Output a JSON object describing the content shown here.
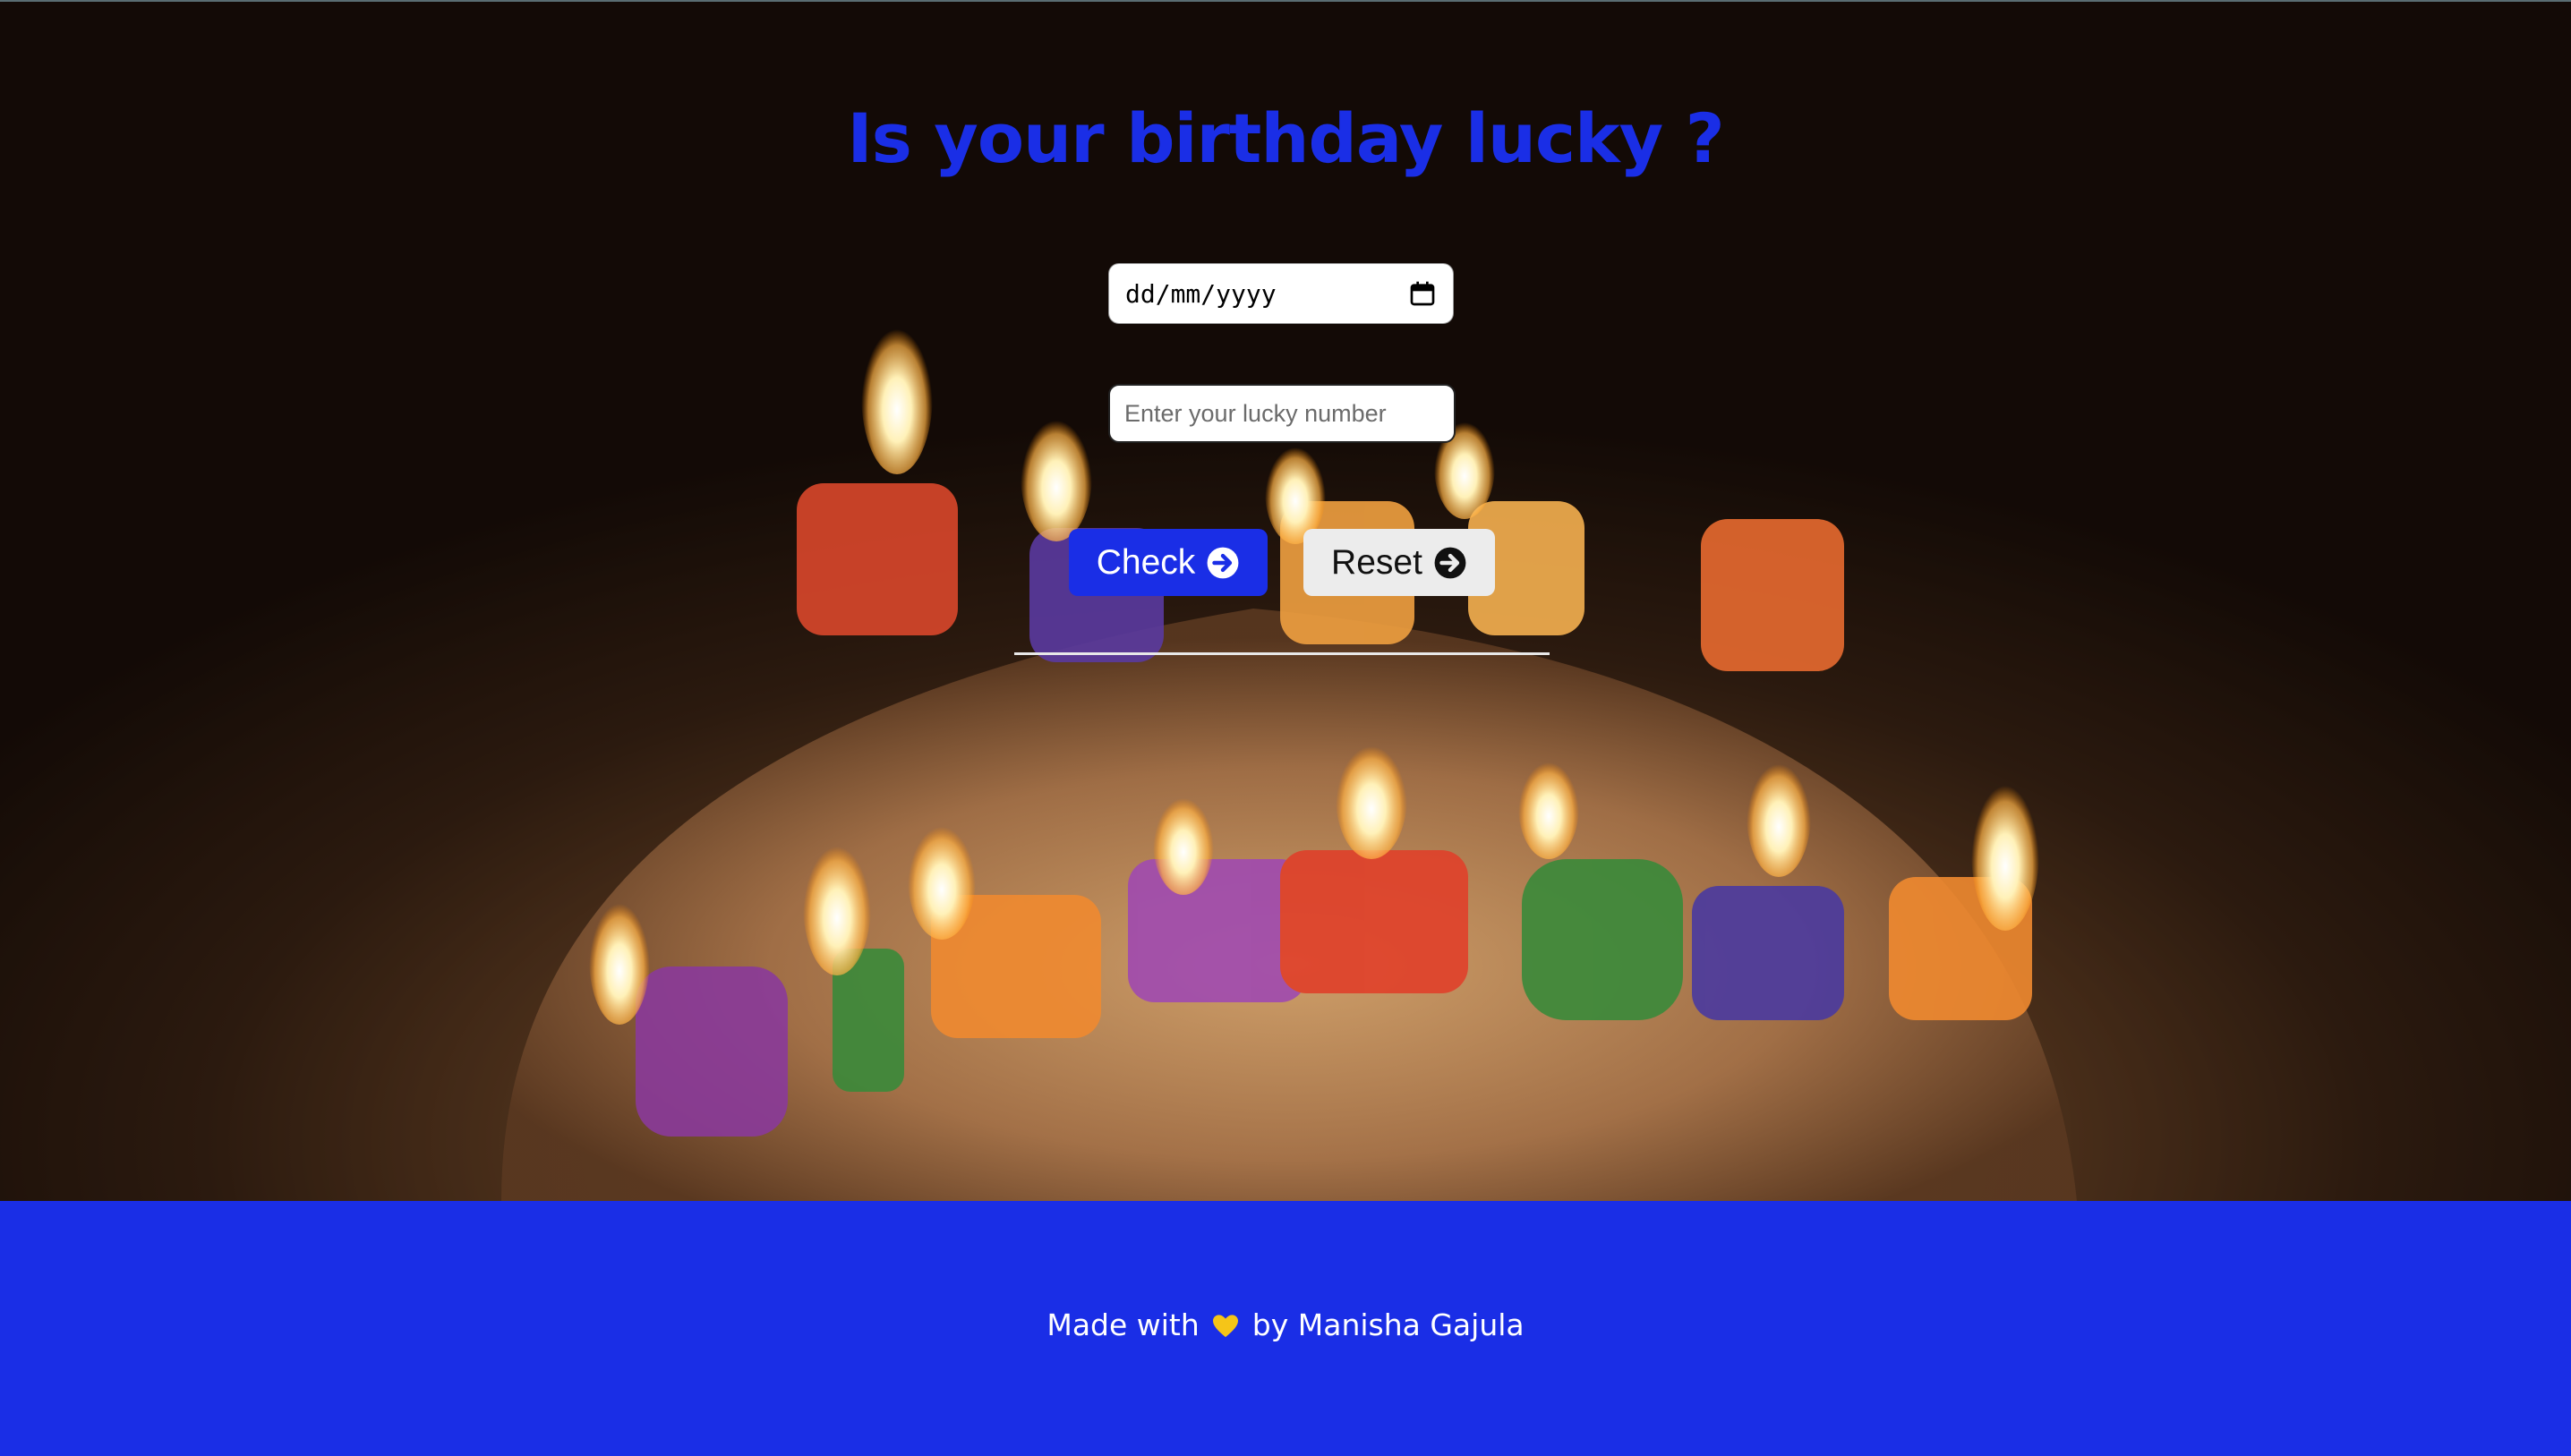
{
  "page": {
    "title": "Is your birthday lucky ?"
  },
  "form": {
    "date_placeholder": "dd/mm/yyyy",
    "lucky_placeholder": "Enter your lucky number",
    "check_label": "Check",
    "reset_label": "Reset"
  },
  "footer": {
    "prefix": "Made with",
    "suffix": "by Manisha Gajula"
  },
  "icons": {
    "calendar": "calendar-icon",
    "check_arrow": "arrow-right-circle-icon",
    "reset_arrow": "arrow-right-circle-icon",
    "heart": "yellow-heart-icon"
  },
  "colors": {
    "accent": "#1a2ee6",
    "reset_bg": "#ececec",
    "heart": "#f5c518"
  }
}
